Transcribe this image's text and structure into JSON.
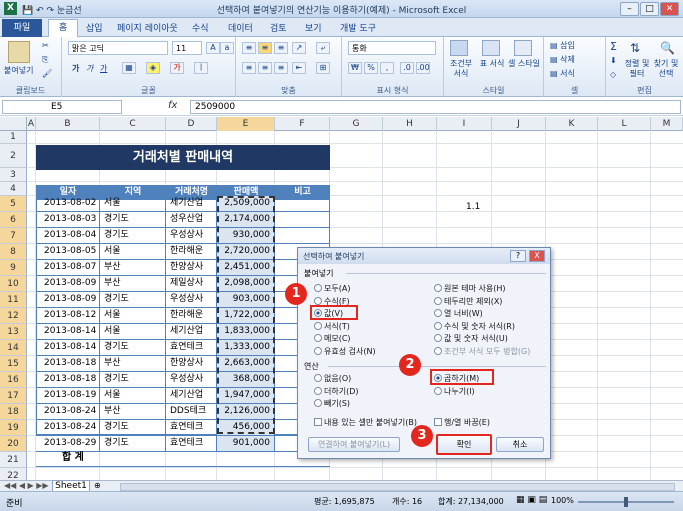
{
  "window": {
    "title": "선택하여 붙여넣기의 연산기능 이용하기(예제) - Microsoft Excel",
    "qat_label": "눈금선"
  },
  "ribbon_tabs": [
    "파일",
    "홈",
    "삽입",
    "페이지 레이아웃",
    "수식",
    "데이터",
    "검토",
    "보기",
    "개발 도구"
  ],
  "ribbon": {
    "paste": "붙여넣기",
    "clipboard": "클립보드",
    "font_name": "맑은 고딕",
    "font_size": "11",
    "font_group": "글꼴",
    "align_group": "맞춤",
    "number_format": "통화",
    "number_group": "표시 형식",
    "cond_fmt": "조건부 서식",
    "table_fmt": "표 서식",
    "cell_style": "셀 스타일",
    "styles_group": "스타일",
    "insert": "삽입",
    "delete": "삭제",
    "format": "서식",
    "cells_group": "셀",
    "sort": "정렬 및 필터",
    "find": "찾기 및 선택",
    "edit_group": "편집"
  },
  "formula_bar": {
    "name_box": "E5",
    "fx": "fx",
    "value": "2509000"
  },
  "columns": [
    "A",
    "B",
    "C",
    "D",
    "E",
    "F",
    "G",
    "H",
    "I",
    "J",
    "K",
    "L",
    "M"
  ],
  "rows": [
    "1",
    "2",
    "3",
    "4",
    "5",
    "6",
    "7",
    "8",
    "9",
    "10",
    "11",
    "12",
    "13",
    "14",
    "15",
    "16",
    "17",
    "18",
    "19",
    "20",
    "21",
    "22",
    "23"
  ],
  "sheet": {
    "banner": "거래처별 판매내역",
    "headers": [
      "일자",
      "지역",
      "거래처명",
      "판매액",
      "비고"
    ],
    "data": [
      [
        "2013-08-02",
        "서울",
        "세기산업",
        "2,509,000"
      ],
      [
        "2013-08-03",
        "경기도",
        "성우산업",
        "2,174,000"
      ],
      [
        "2013-08-04",
        "경기도",
        "우성상사",
        "930,000"
      ],
      [
        "2013-08-05",
        "서울",
        "한라해운",
        "2,720,000"
      ],
      [
        "2013-08-07",
        "부산",
        "한양상사",
        "2,451,000"
      ],
      [
        "2013-08-09",
        "부산",
        "제일상사",
        "2,098,000"
      ],
      [
        "2013-08-09",
        "경기도",
        "우성상사",
        "903,000"
      ],
      [
        "2013-08-12",
        "서울",
        "한라해운",
        "1,722,000"
      ],
      [
        "2013-08-14",
        "서울",
        "세기산업",
        "1,833,000"
      ],
      [
        "2013-08-14",
        "경기도",
        "효연테크",
        "1,333,000"
      ],
      [
        "2013-08-18",
        "부산",
        "한양상사",
        "2,663,000"
      ],
      [
        "2013-08-18",
        "경기도",
        "우성상사",
        "368,000"
      ],
      [
        "2013-08-19",
        "서울",
        "세기산업",
        "1,947,000"
      ],
      [
        "2013-08-24",
        "부산",
        "DDS테크",
        "2,126,000"
      ],
      [
        "2013-08-24",
        "경기도",
        "효연테크",
        "456,000"
      ],
      [
        "2013-08-29",
        "경기도",
        "효연테크",
        "901,000"
      ]
    ],
    "total_label": "합 계",
    "i5_value": "1.1"
  },
  "dialog": {
    "title": "선택하여 붙여넣기",
    "help": "?",
    "close": "X",
    "paste_section": "붙여넣기",
    "paste_left": [
      "모두(A)",
      "수식(F)",
      "값(V)",
      "서식(T)",
      "메모(C)",
      "유효성 검사(N)"
    ],
    "paste_right": [
      "원본 테마 사용(H)",
      "테두리만 제외(X)",
      "열 너비(W)",
      "수식 및 숫자 서식(R)",
      "값 및 숫자 서식(U)",
      "조건부 서식 모두 병합(G)"
    ],
    "op_section": "연산",
    "op_left": [
      "없음(O)",
      "더하기(D)",
      "빼기(S)"
    ],
    "op_right": [
      "곱하기(M)",
      "나누기(I)"
    ],
    "skip_blanks": "내용 있는 셀만 붙여넣기(B)",
    "transpose": "행/열 바꿈(E)",
    "paste_link": "연결하여 붙여넣기(L)",
    "ok": "확인",
    "cancel": "취소"
  },
  "badges": [
    "1",
    "2",
    "3"
  ],
  "sheet_tab": "Sheet1",
  "status": {
    "ready": "준비",
    "avg": "평균: 1,695,875",
    "count": "개수: 16",
    "sum": "합계: 27,134,000",
    "zoom": "100%"
  },
  "colors": {
    "banner": "#1f3864",
    "header": "#4f81bd",
    "accent_red": "#e3261e"
  }
}
